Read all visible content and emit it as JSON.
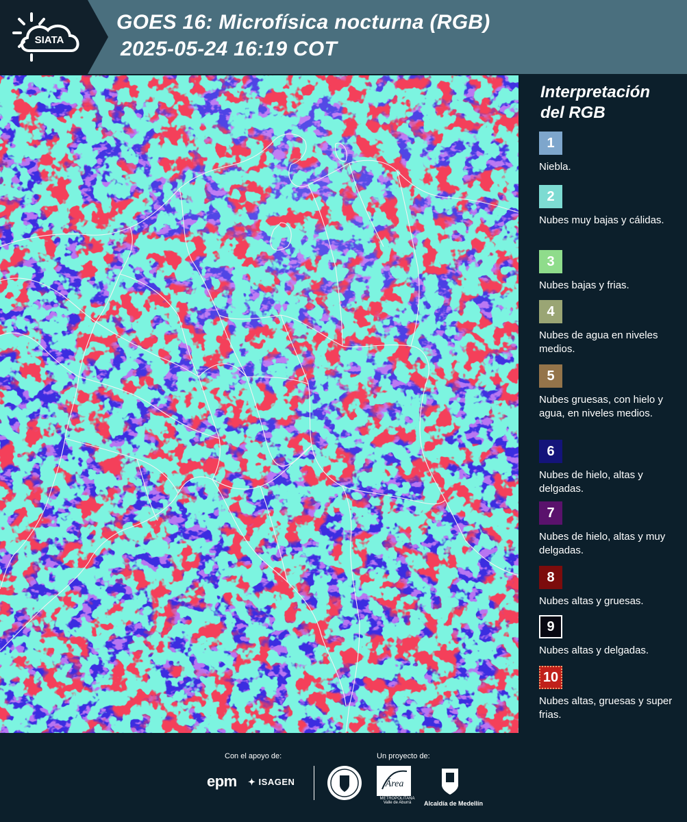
{
  "header": {
    "logo_text": "SIATA",
    "title_line1": "GOES 16: Microfísica nocturna (RGB)",
    "title_line2": "2025-05-24 16:19 COT"
  },
  "legend": {
    "title": "Interpretación del RGB",
    "items": [
      {
        "number": "1",
        "label": "Niebla.",
        "color": "#7ea6cc"
      },
      {
        "number": "2",
        "label": "Nubes muy bajas y cálidas.",
        "color": "#7ddbd2"
      },
      {
        "number": "3",
        "label": "Nubes bajas y frias.",
        "color": "#8fdc8b"
      },
      {
        "number": "4",
        "label": "Nubes de agua en niveles medios.",
        "color": "#9aa574"
      },
      {
        "number": "5",
        "label": "Nubes gruesas, con hielo y agua, en niveles medios.",
        "color": "#94744a"
      },
      {
        "number": "6",
        "label": "Nubes de hielo, altas y delgadas.",
        "color": "#14147a"
      },
      {
        "number": "7",
        "label": "Nubes de hielo, altas y muy delgadas.",
        "color": "#5a126c"
      },
      {
        "number": "8",
        "label": "Nubes altas y gruesas.",
        "color": "#7c0c0c"
      },
      {
        "number": "9",
        "label": "Nubes altas y delgadas.",
        "color": "#080812"
      },
      {
        "number": "10",
        "label": "Nubes altas, gruesas y super frias.",
        "color": "#c0201a"
      }
    ]
  },
  "footer": {
    "support_caption": "Con el apoyo de:",
    "project_caption": "Un proyecto de:",
    "epm": "epm",
    "isagen": "ISAGEN",
    "area_logo": "Área",
    "area_subtitle": "METROPOLITANA Valle de Aburrá",
    "alcaldia": "Alcaldía de Medellín"
  },
  "colors": {
    "header_bg": "#4a6f7e",
    "page_bg": "#0c1f2b",
    "map_base": "#3b2de0",
    "cloud_red": "#e0141e",
    "cloud_cyan": "#35e0c0"
  }
}
